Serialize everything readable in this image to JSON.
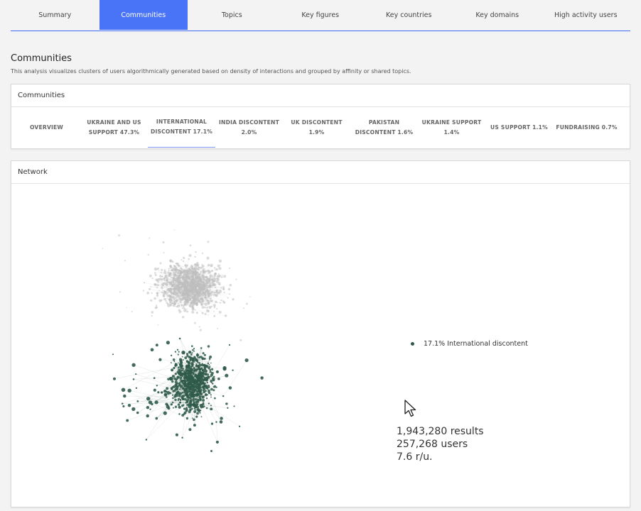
{
  "tabs": [
    {
      "label": "Summary",
      "active": false
    },
    {
      "label": "Communities",
      "active": true
    },
    {
      "label": "Topics",
      "active": false
    },
    {
      "label": "Key figures",
      "active": false
    },
    {
      "label": "Key countries",
      "active": false
    },
    {
      "label": "Key domains",
      "active": false
    },
    {
      "label": "High activity users",
      "active": false
    }
  ],
  "section": {
    "title": "Communities",
    "description": "This analysis visualizes clusters of users algorithmically generated based on density of interactions and grouped by affinity or shared topics."
  },
  "communities_card": {
    "title": "Communities",
    "subtabs": [
      {
        "label": "OVERVIEW",
        "active": false
      },
      {
        "label": "UKRAINE AND US SUPPORT 47.3%",
        "active": false
      },
      {
        "label": "INTERNATIONAL DISCONTENT 17.1%",
        "active": true
      },
      {
        "label": "INDIA DISCONTENT 2.0%",
        "active": false
      },
      {
        "label": "UK DISCONTENT 1.9%",
        "active": false
      },
      {
        "label": "PAKISTAN DISCONTENT 1.6%",
        "active": false
      },
      {
        "label": "UKRAINE SUPPORT 1.4%",
        "active": false
      },
      {
        "label": "US SUPPORT 1.1%",
        "active": false
      },
      {
        "label": "FUNDRAISING 0.7%",
        "active": false
      }
    ]
  },
  "network_card": {
    "title": "Network",
    "legend": "17.1% International  discontent",
    "stats": {
      "results": "1,943,280 results",
      "users": "257,268 users",
      "ratio": "7.6 r/u."
    }
  },
  "colors": {
    "accent": "#4a74f7",
    "highlight_cluster": "#2f5a4a",
    "other_cluster": "#bdbdbd"
  }
}
